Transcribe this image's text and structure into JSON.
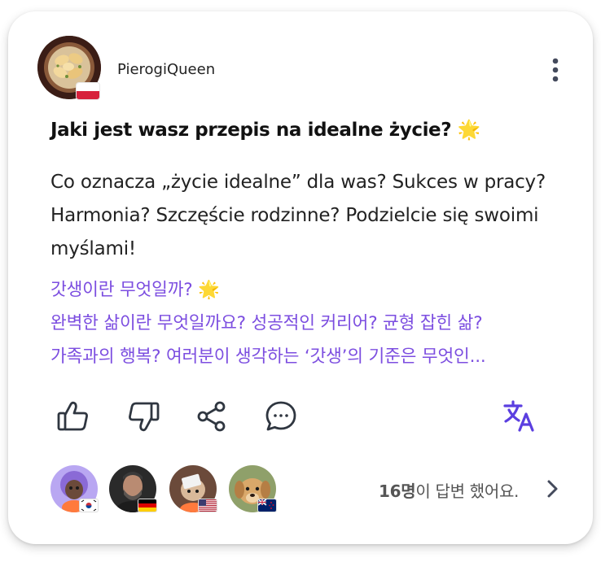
{
  "post": {
    "author": {
      "username": "PierogiQueen",
      "avatar": "pierogi-plate-avatar",
      "flag": "poland-flag"
    },
    "title": "Jaki jest wasz przepis na idealne życie? 🌟",
    "body": "Co oznacza „życie idealne” dla was? Sukces w pracy? Harmonia? Szczęście rodzinne? Podzielcie się swoimi myślami!",
    "translation": {
      "lines": [
        "갓생이란 무엇일까? 🌟",
        "완벽한 삶이란 무엇일까요? 성공적인 커리어? 균형 잡힌 삶?",
        "가족과의 행복? 여러분이 생각하는 ‘갓생’의 기준은 무엇인..."
      ]
    }
  },
  "actions": {
    "like": "thumbs-up-icon",
    "dislike": "thumbs-down-icon",
    "share": "share-icon",
    "comment": "chat-bubble-icon",
    "translate": "translate-icon"
  },
  "responders": {
    "avatars": [
      {
        "name": "purple-character-avatar",
        "flag": "south-korea-flag"
      },
      {
        "name": "bearded-man-avatar",
        "flag": "germany-flag"
      },
      {
        "name": "character-with-sign-avatar",
        "flag": "usa-flag"
      },
      {
        "name": "puppy-avatar",
        "flag": "new-zealand-flag"
      }
    ],
    "count_number": "16명",
    "count_text": "이 답변 했어요."
  },
  "colors": {
    "accent": "#7c4ee0",
    "icon": "#2f3640",
    "translate_icon": "#5b3fe0",
    "text": "#222222"
  }
}
